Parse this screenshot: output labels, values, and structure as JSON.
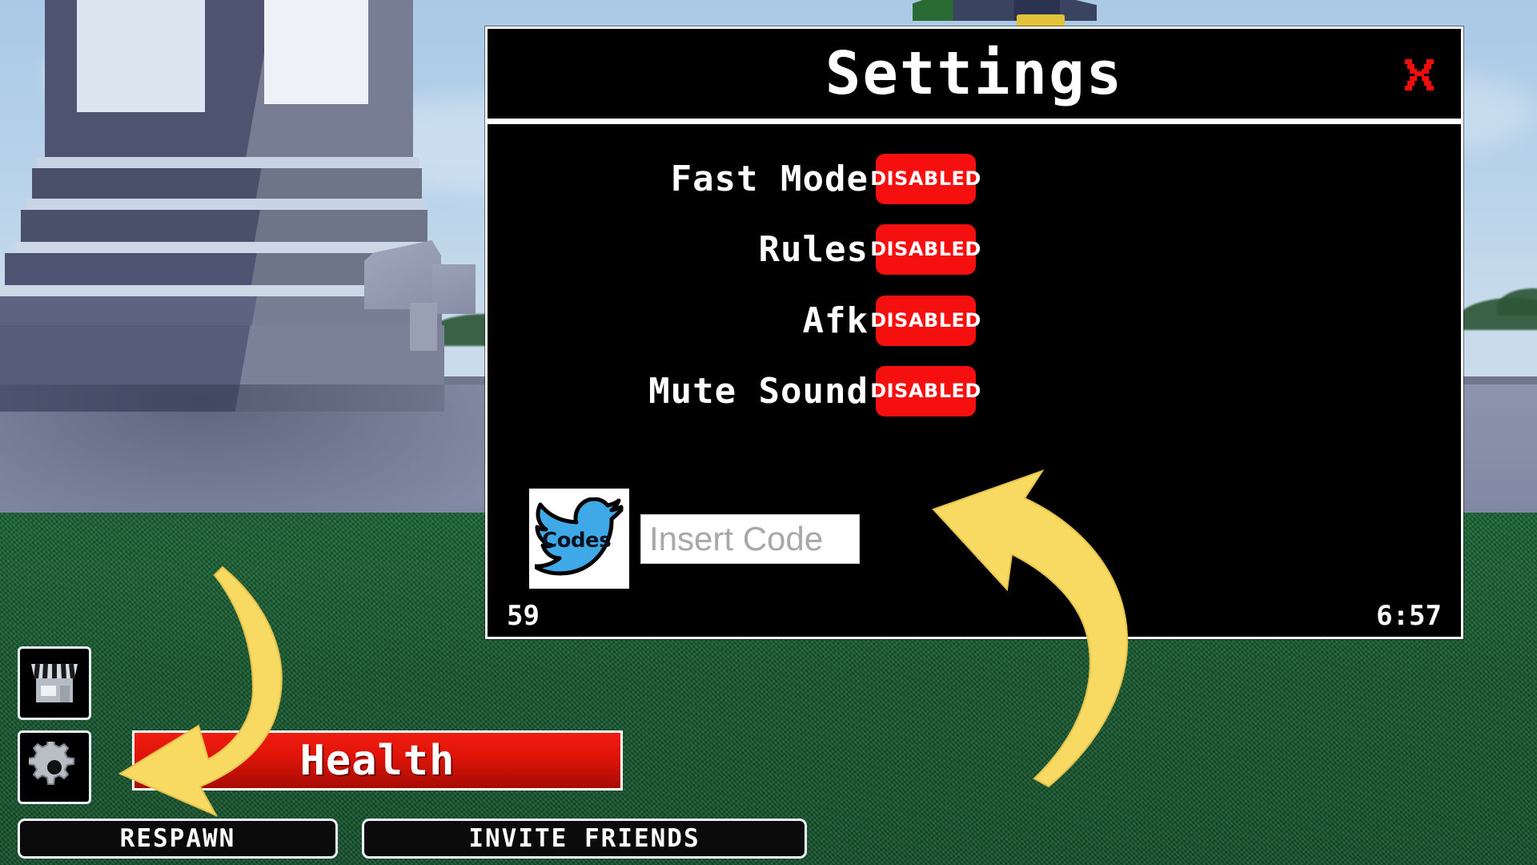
{
  "panel": {
    "title": "Settings",
    "close_icon": "close-x-icon",
    "accent_red": "#f50f0f",
    "border_color": "#ffffff",
    "background": "#000000",
    "rows": [
      {
        "label": "Fast Mode",
        "toggle_label": "DISABLED",
        "state": "disabled"
      },
      {
        "label": "Rules",
        "toggle_label": "DISABLED",
        "state": "disabled"
      },
      {
        "label": "Afk",
        "toggle_label": "DISABLED",
        "state": "disabled"
      },
      {
        "label": "Mute Sound",
        "toggle_label": "DISABLED",
        "state": "disabled"
      }
    ],
    "codes": {
      "icon_name": "twitter-codes-icon",
      "icon_word": "Codes",
      "input_placeholder": "Insert Code",
      "input_value": ""
    },
    "footer": {
      "coin_count": "59",
      "timer": "6:57"
    }
  },
  "hud": {
    "shop_button": {
      "name": "shop-button",
      "icon": "shop-icon"
    },
    "settings_button": {
      "name": "settings-button",
      "icon": "gear-icon"
    },
    "health_button": {
      "label": "Health"
    },
    "respawn_button": {
      "label": "RESPAWN"
    },
    "invite_button": {
      "label": "INVITE FRIENDS"
    }
  },
  "annotations": {
    "arrow_color": "#f8d962",
    "arrow_left": {
      "name": "annotation-arrow-to-health",
      "points_to": "Health"
    },
    "arrow_right": {
      "name": "annotation-arrow-to-code-input",
      "points_to": "Insert Code"
    }
  },
  "scene": {
    "sky_color": "#b9d3ea",
    "grass_color": "#1a5f33",
    "stone_color": "#888ea8"
  }
}
